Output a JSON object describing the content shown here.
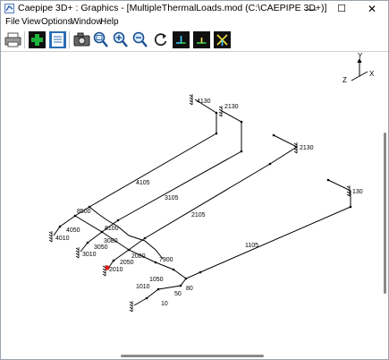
{
  "window": {
    "title": "Caepipe 3D+ : Graphics - [MultipleThermalLoads.mod (C:\\CAEPIPE 3D+)]"
  },
  "window_controls": {
    "minimize": "—",
    "maximize": "☐",
    "close": "✕"
  },
  "menu": [
    "File",
    "View",
    "Options",
    "Window",
    "Help"
  ],
  "toolbar": {
    "buttons": [
      "print-icon",
      "model-icon",
      "list-icon",
      "camera-icon",
      "zoom-window-icon",
      "zoom-in-icon",
      "zoom-out-icon",
      "rotate-icon",
      "view-front-icon",
      "view-top-icon",
      "view-side-icon"
    ]
  },
  "axes": {
    "y": "Y",
    "z": "Z",
    "x": "X"
  },
  "nodes": [
    "4130",
    "2130",
    "2130",
    "4105",
    "3105",
    "130",
    "2105",
    "8500",
    "4050",
    "4010",
    "1105",
    "3050",
    "3010",
    "3080",
    "8100",
    "2080",
    "2050",
    "7900",
    "2010",
    "1050",
    "1010",
    "80",
    "50",
    "10"
  ]
}
